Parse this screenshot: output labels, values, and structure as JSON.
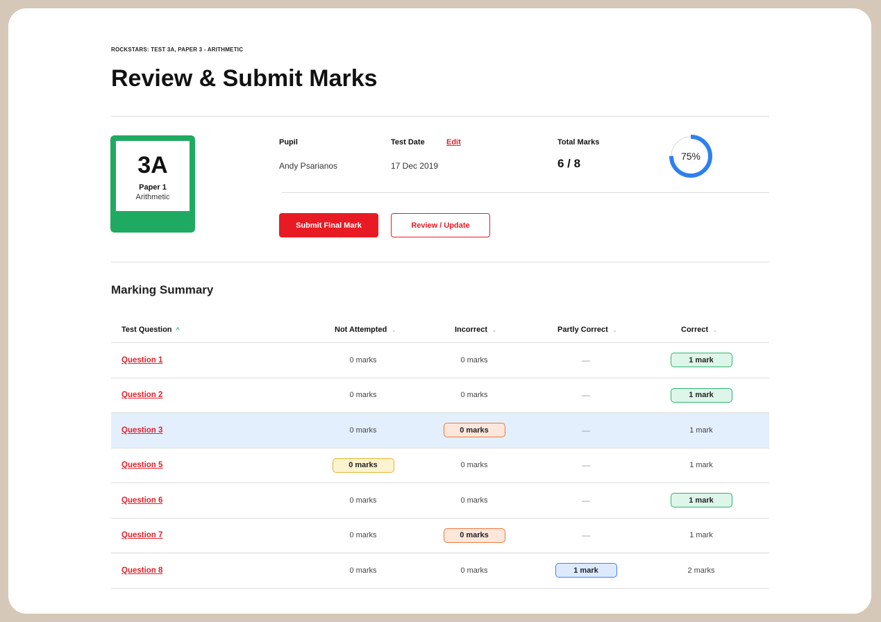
{
  "breadcrumb": "ROCKSTARS: TEST 3A, PAPER 3 - ARITHMETIC",
  "page_title": "Review & Submit Marks",
  "card": {
    "code": "3A",
    "paper": "Paper 1",
    "subject": "Arithmetic",
    "color": "#1faa62"
  },
  "summary": {
    "pupil_label": "Pupil",
    "pupil_name": "Andy Psarianos",
    "test_date_label": "Test Date",
    "edit_label": "Edit",
    "test_date": "17 Dec 2019",
    "total_marks_label": "Total Marks",
    "total_marks": "6 / 8",
    "percent_label": "75%",
    "percent_value": 0.75
  },
  "actions": {
    "submit_label": "Submit Final Mark",
    "review_label": "Review / Update"
  },
  "marking": {
    "title": "Marking Summary",
    "columns": {
      "question": "Test Question",
      "not_attempted": "Not Attempted",
      "incorrect": "Incorrect",
      "partly_correct": "Partly Correct",
      "correct": "Correct"
    },
    "rows": [
      {
        "question": "Question 1",
        "not_attempted": "0 marks",
        "incorrect": "0 marks",
        "partly_correct": "—",
        "correct": "1 mark",
        "highlight": "correct",
        "selected": false
      },
      {
        "question": "Question 2",
        "not_attempted": "0 marks",
        "incorrect": "0 marks",
        "partly_correct": "—",
        "correct": "1 mark",
        "highlight": "correct",
        "selected": false
      },
      {
        "question": "Question 3",
        "not_attempted": "0 marks",
        "incorrect": "0 marks",
        "partly_correct": "—",
        "correct": "1 mark",
        "highlight": "incorrect",
        "selected": true
      },
      {
        "question": "Question 5",
        "not_attempted": "0 marks",
        "incorrect": "0 marks",
        "partly_correct": "—",
        "correct": "1 mark",
        "highlight": "not_attempted",
        "selected": false
      },
      {
        "question": "Question 6",
        "not_attempted": "0 marks",
        "incorrect": "0 marks",
        "partly_correct": "—",
        "correct": "1 mark",
        "highlight": "correct",
        "selected": false
      },
      {
        "question": "Question 7",
        "not_attempted": "0 marks",
        "incorrect": "0 marks",
        "partly_correct": "—",
        "correct": "1 mark",
        "highlight": "incorrect",
        "selected": false
      },
      {
        "question": "Question 8",
        "not_attempted": "0 marks",
        "incorrect": "0 marks",
        "partly_correct": "1 mark",
        "correct": "2 marks",
        "highlight": "partly_correct",
        "selected": false
      }
    ]
  },
  "colors": {
    "accent_red": "#e81b24",
    "correct_green": "#2bb56e",
    "incorrect_orange": "#ec7a3d",
    "not_attempted_yellow": "#e4b62e",
    "partly_blue": "#3b82f6",
    "selected_row": "#e4effd",
    "progress_blue": "#2f80ed"
  }
}
